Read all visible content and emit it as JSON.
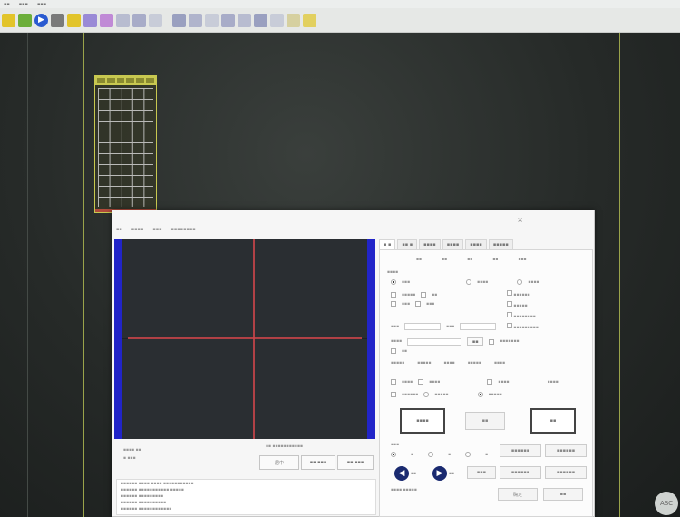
{
  "dialog": {
    "close_glyph": "×",
    "canvas_buttons": {
      "center": "居中"
    },
    "bottom_buttons": {
      "ok": "确定"
    }
  },
  "corner_badge": "ASC",
  "colors": {
    "toolbar_icon_yellow": "#e2c42a",
    "toolbar_icon_blue": "#2a5ad0",
    "toolbar_icon_purple": "#9a8ad6",
    "camera_border": "#2124c8",
    "crosshair": "#c9444a",
    "board_outline": "#c8c850",
    "guide_line": "#9aa34a"
  },
  "icons": [
    "folder-icon",
    "save-icon",
    "play-icon",
    "layers-icon",
    "note-icon",
    "shape-icon",
    "shape-icon",
    "tool-icon",
    "tool-icon",
    "tool-icon",
    "tool-icon",
    "tool-icon",
    "tool-icon",
    "tool-icon",
    "tool-icon",
    "tool-icon",
    "tool-icon",
    "tool-icon",
    "tool-icon"
  ]
}
